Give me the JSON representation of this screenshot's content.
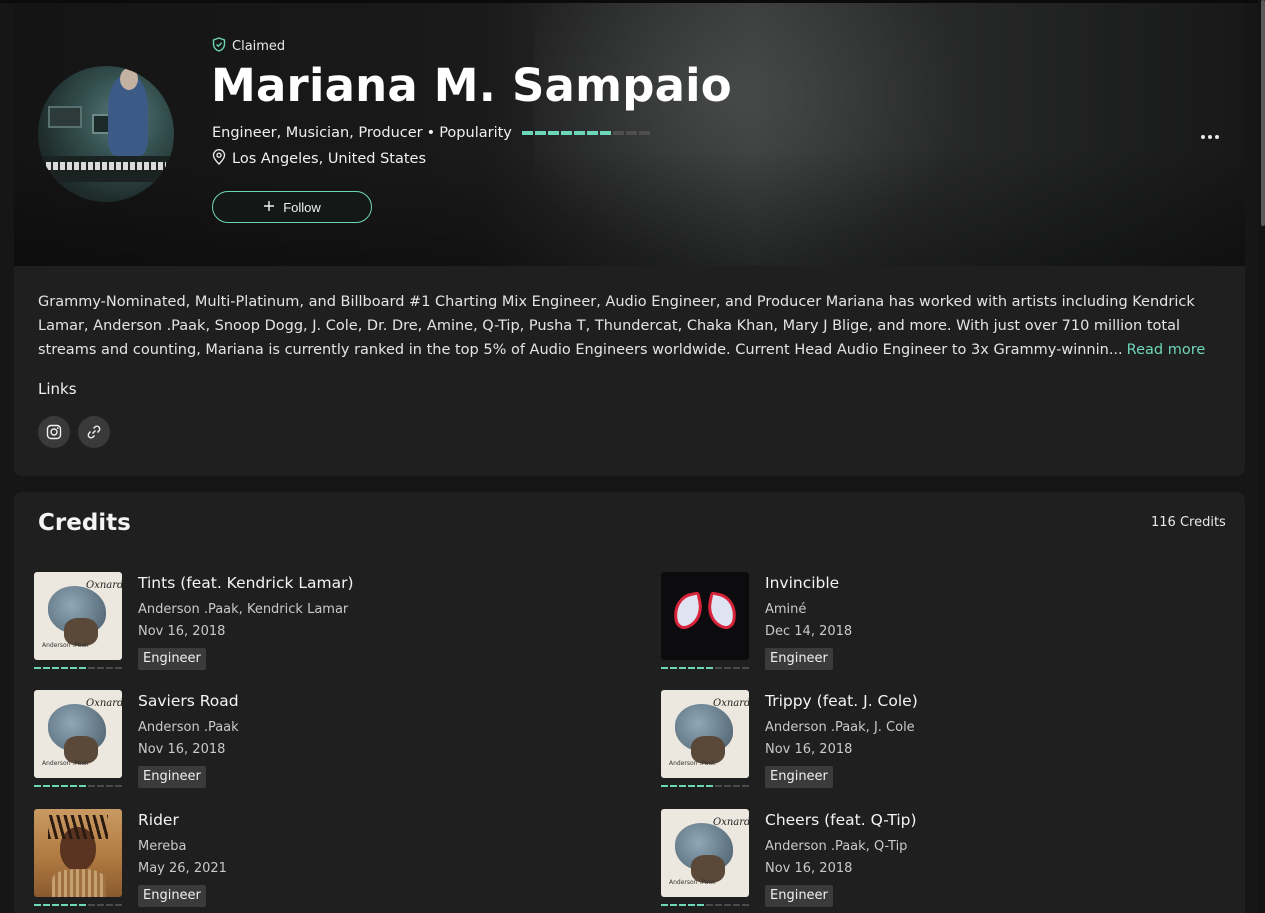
{
  "profile": {
    "claimed_label": "Claimed",
    "name": "Mariana M. Sampaio",
    "roles": "Engineer, Musician, Producer",
    "separator": "•",
    "popularity_label": "Popularity",
    "popularity_filled": 7,
    "popularity_total": 10,
    "location": "Los Angeles, United States",
    "follow_label": "Follow"
  },
  "about": {
    "bio": "Grammy-Nominated, Multi-Platinum, and Billboard #1 Charting Mix Engineer, Audio Engineer, and Producer Mariana has worked with artists including Kendrick Lamar, Anderson .Paak, Snoop Dogg, J. Cole, Dr. Dre, Amine, Q-Tip, Pusha T, Thundercat, Chaka Khan, Mary J Blige, and more. With just over 710 million total streams and counting, Mariana is currently ranked in the top 5% of Audio Engineers worldwide. Current Head Audio Engineer to 3x Grammy-winnin...",
    "read_more": "Read more",
    "links_title": "Links",
    "links": [
      {
        "icon": "instagram-icon"
      },
      {
        "icon": "website-link-icon"
      }
    ]
  },
  "credits": {
    "title": "Credits",
    "count": "116 Credits",
    "items": [
      {
        "title": "Tints (feat. Kendrick Lamar)",
        "artists": "Anderson .Paak, Kendrick Lamar",
        "date": "Nov 16, 2018",
        "role": "Engineer",
        "cover": "oxnard",
        "popularity": 6
      },
      {
        "title": "Invincible",
        "artists": "Aminé",
        "date": "Dec 14, 2018",
        "role": "Engineer",
        "cover": "spider",
        "popularity": 6
      },
      {
        "title": "Saviers Road",
        "artists": "Anderson .Paak",
        "date": "Nov 16, 2018",
        "role": "Engineer",
        "cover": "oxnard",
        "popularity": 6
      },
      {
        "title": "Trippy (feat. J. Cole)",
        "artists": "Anderson .Paak, J. Cole",
        "date": "Nov 16, 2018",
        "role": "Engineer",
        "cover": "oxnard",
        "popularity": 6
      },
      {
        "title": "Rider",
        "artists": "Mereba",
        "date": "May 26, 2021",
        "role": "Engineer",
        "cover": "rider",
        "popularity": 6
      },
      {
        "title": "Cheers (feat. Q-Tip)",
        "artists": "Anderson .Paak, Q-Tip",
        "date": "Nov 16, 2018",
        "role": "Engineer",
        "cover": "oxnard",
        "popularity": 5
      }
    ]
  },
  "colors": {
    "accent": "#6ed6b8",
    "background": "#161616",
    "card": "#1f1f1f",
    "tag": "#3b3b3b"
  }
}
